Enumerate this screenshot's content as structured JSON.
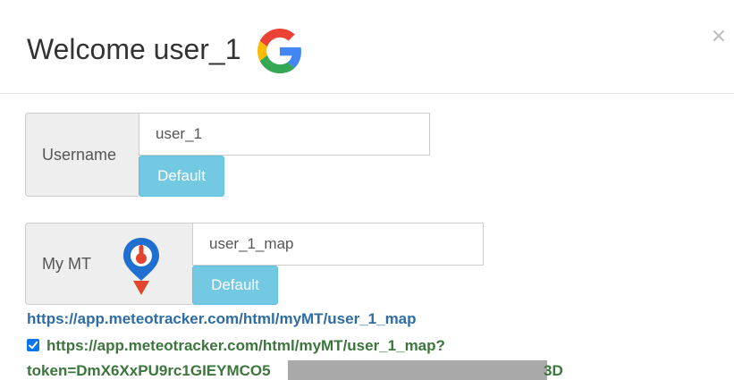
{
  "header": {
    "title": "Welcome user_1",
    "close_symbol": "×"
  },
  "username_group": {
    "label": "Username",
    "value": "user_1",
    "default_label": "Default"
  },
  "mymt_group": {
    "label": "My MT",
    "value": "user_1_map",
    "default_label": "Default"
  },
  "links": {
    "map_url": "https://app.meteotracker.com/html/myMT/user_1_map",
    "token_url_line1": "https://app.meteotracker.com/html/myMT/user_1_map?",
    "token_url_line2_start": "token=DmX6XxPU9rc1GIEYMCO5",
    "token_url_line2_end": "3D",
    "token_checked": true
  },
  "icons": {
    "google": "google-g-logo",
    "meteotracker": "meteotracker-logo",
    "close": "close-icon",
    "check": "check-icon"
  },
  "colors": {
    "link_blue": "#2e6da4",
    "token_green": "#3c763d",
    "default_button": "#5bc0de",
    "checkbox_blue": "#0a76e8",
    "redaction_gray": "#a9a9a9",
    "mt_blue": "#1f6fd1",
    "mt_red": "#e0452e"
  }
}
